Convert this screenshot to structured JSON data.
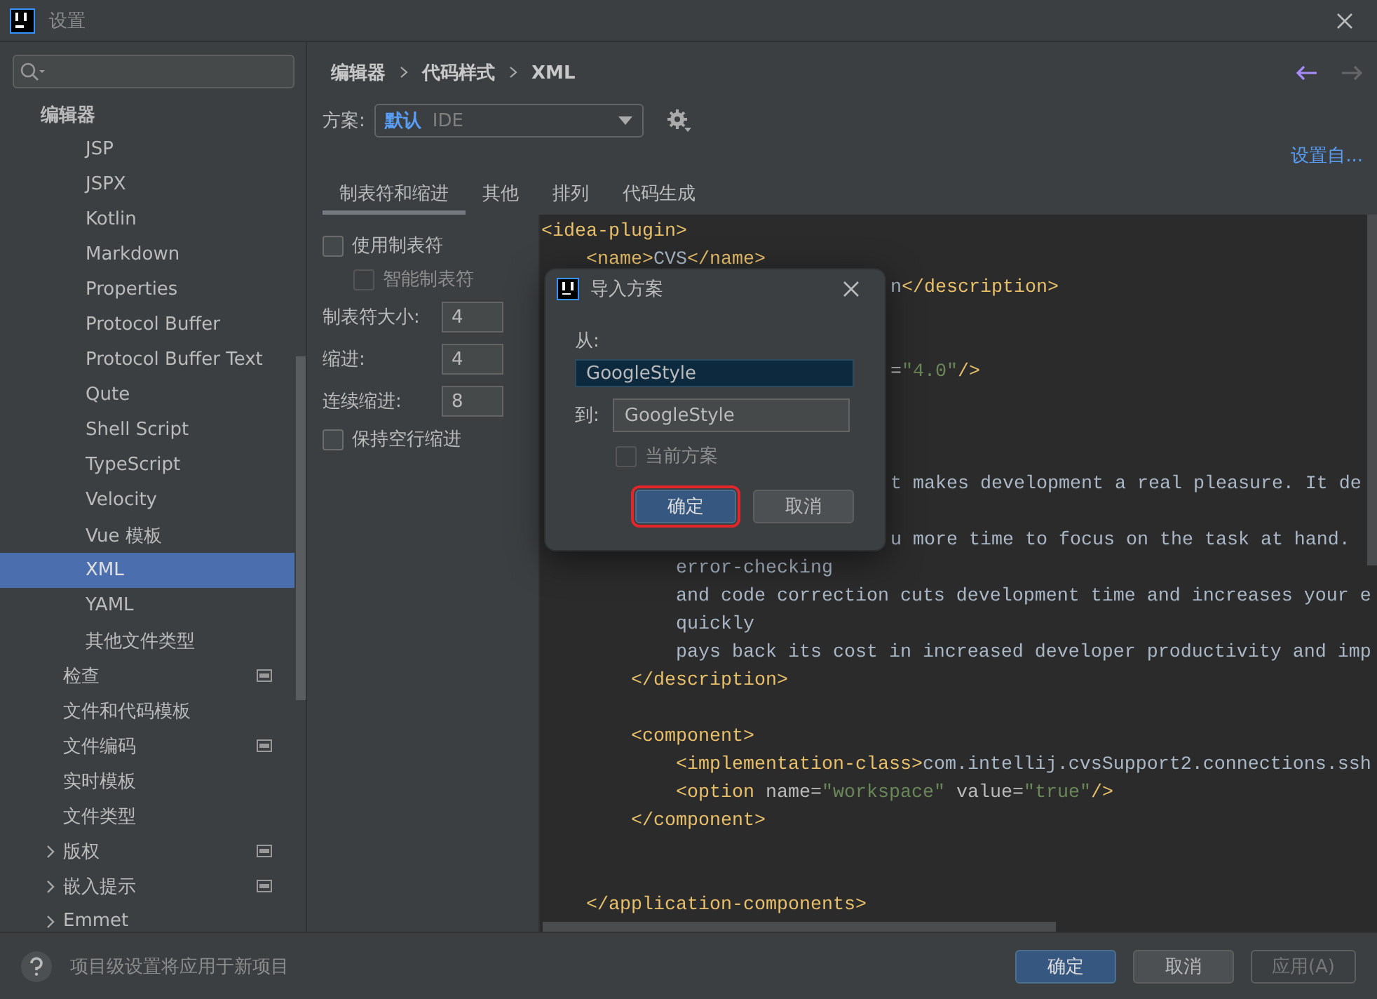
{
  "window": {
    "title": "设置"
  },
  "sidebar": {
    "items": [
      {
        "label": "编辑器",
        "children": [
          {
            "children": [
              {
                "label": "JSP",
                "selected": false
              },
              {
                "label": "JSPX",
                "selected": false
              },
              {
                "label": "Kotlin",
                "selected": false
              },
              {
                "label": "Markdown",
                "selected": false
              },
              {
                "label": "Properties",
                "selected": false
              },
              {
                "label": "Protocol Buffer",
                "selected": false
              },
              {
                "label": "Protocol Buffer Text",
                "selected": false
              },
              {
                "label": "Qute",
                "selected": false
              },
              {
                "label": "Shell Script",
                "selected": false
              },
              {
                "label": "TypeScript",
                "selected": false
              },
              {
                "label": "Velocity",
                "selected": false
              },
              {
                "label": "Vue 模板",
                "selected": false
              },
              {
                "label": "XML",
                "selected": true
              },
              {
                "label": "YAML",
                "selected": false
              },
              {
                "label": "其他文件类型",
                "selected": false
              }
            ]
          },
          {
            "label": "检查",
            "selected": false,
            "project": true
          },
          {
            "label": "文件和代码模板",
            "selected": false
          },
          {
            "label": "文件编码",
            "selected": false,
            "project": true
          },
          {
            "label": "实时模板",
            "selected": false
          },
          {
            "label": "文件类型",
            "selected": false
          },
          {
            "label": "版权",
            "selected": false,
            "project": true,
            "expanded": false
          },
          {
            "label": "嵌入提示",
            "selected": false,
            "project": true,
            "expanded": false
          },
          {
            "label": "Emmet",
            "selected": false,
            "expanded": false
          }
        ]
      }
    ]
  },
  "breadcrumb": [
    "编辑器",
    "代码样式",
    "XML"
  ],
  "nav": {
    "back_enabled": true,
    "forward_enabled": false
  },
  "scheme": {
    "label": "方案:",
    "name": "默认",
    "scope": "IDE"
  },
  "set_from_link": "设置自...",
  "tabs": [
    {
      "label": "制表符和缩进",
      "selected": true
    },
    {
      "label": "其他",
      "selected": false
    },
    {
      "label": "排列",
      "selected": false
    },
    {
      "label": "代码生成",
      "selected": false
    }
  ],
  "options": [
    {
      "kind": "checkbox",
      "label": "使用制表符",
      "checked": false,
      "disabled": false,
      "children": [
        {
          "label": "智能制表符",
          "checked": false,
          "disabled": true
        }
      ]
    },
    {
      "kind": "number",
      "label": "制表符大小:",
      "value": "4"
    },
    {
      "kind": "number",
      "label": "缩进:",
      "value": "4"
    },
    {
      "kind": "number",
      "label": "连续缩进:",
      "value": "8"
    },
    {
      "kind": "checkbox",
      "label": "保持空行缩进",
      "checked": false,
      "disabled": false
    }
  ],
  "editor": {
    "lines": [
      {
        "kind": "full",
        "tokens": [
          {
            "kind": "tag",
            "text": "<idea-plugin>"
          }
        ]
      },
      {
        "kind": "full",
        "tokens": [
          {
            "kind": "tag",
            "text": "    <name>"
          },
          {
            "kind": "text",
            "text": "CVS"
          },
          {
            "kind": "tag",
            "text": "</name>"
          }
        ]
      },
      {
        "kind": "clipped",
        "tokens": [
          {
            "kind": "text",
            "text": "n"
          },
          {
            "kind": "tag",
            "text": "</description>"
          }
        ]
      },
      {
        "kind": "blank"
      },
      {
        "kind": "blank"
      },
      {
        "kind": "clipped",
        "tokens": [
          {
            "kind": "attr",
            "text": "="
          },
          {
            "kind": "value",
            "text": "\"4.0\""
          },
          {
            "kind": "tag",
            "text": "/>"
          }
        ]
      },
      {
        "kind": "blank"
      },
      {
        "kind": "blank"
      },
      {
        "kind": "blank"
      },
      {
        "kind": "clipped",
        "tokens": [
          {
            "kind": "text",
            "text": "t makes development a real pleasure. It de"
          }
        ]
      },
      {
        "kind": "blank"
      },
      {
        "kind": "clipped",
        "tokens": [
          {
            "kind": "text",
            "text": "u more time to focus on the task at hand."
          }
        ]
      },
      {
        "kind": "full",
        "tokens": [
          {
            "kind": "text",
            "text": "            error-checking"
          }
        ]
      },
      {
        "kind": "full",
        "tokens": [
          {
            "kind": "text",
            "text": "            and code correction cuts development time and increases your e"
          }
        ]
      },
      {
        "kind": "full",
        "tokens": [
          {
            "kind": "text",
            "text": "            quickly"
          }
        ]
      },
      {
        "kind": "full",
        "tokens": [
          {
            "kind": "text",
            "text": "            pays back its cost in increased developer productivity and imp"
          }
        ]
      },
      {
        "kind": "full",
        "tokens": [
          {
            "kind": "tag",
            "text": "        </description>"
          }
        ]
      },
      {
        "kind": "blank"
      },
      {
        "kind": "full",
        "tokens": [
          {
            "kind": "tag",
            "text": "        <component>"
          }
        ]
      },
      {
        "kind": "full",
        "tokens": [
          {
            "kind": "tag",
            "text": "            <implementation-class>"
          },
          {
            "kind": "text",
            "text": "com.intellij.cvsSupport2.connections.ssh"
          }
        ]
      },
      {
        "kind": "full",
        "tokens": [
          {
            "kind": "tag",
            "text": "            <option "
          },
          {
            "kind": "attr",
            "text": "name="
          },
          {
            "kind": "value",
            "text": "\"workspace\""
          },
          {
            "kind": "attr",
            "text": " value="
          },
          {
            "kind": "value",
            "text": "\"true\""
          },
          {
            "kind": "tag",
            "text": "/>"
          }
        ]
      },
      {
        "kind": "full",
        "tokens": [
          {
            "kind": "tag",
            "text": "        </component>"
          }
        ]
      },
      {
        "kind": "blank"
      },
      {
        "kind": "blank"
      },
      {
        "kind": "full",
        "tokens": [
          {
            "kind": "tag",
            "text": "    </application-components>"
          }
        ]
      }
    ]
  },
  "dialog": {
    "title": "导入方案",
    "from_label": "从:",
    "from_value": "GoogleStyle",
    "to_label": "到:",
    "to_value": "GoogleStyle",
    "current": {
      "label": "当前方案",
      "checked": false,
      "disabled": true
    },
    "buttons": [
      {
        "label": "确定",
        "kind": "primary",
        "highlighted": true
      },
      {
        "label": "取消",
        "kind": "normal",
        "highlighted": false
      }
    ]
  },
  "footer": {
    "hint": "项目级设置将应用于新项目",
    "buttons": [
      {
        "label": "确定",
        "kind": "primary",
        "disabled": false
      },
      {
        "label": "取消",
        "kind": "normal",
        "disabled": false
      },
      {
        "label": "应用(A)",
        "kind": "normal",
        "disabled": true
      }
    ]
  }
}
